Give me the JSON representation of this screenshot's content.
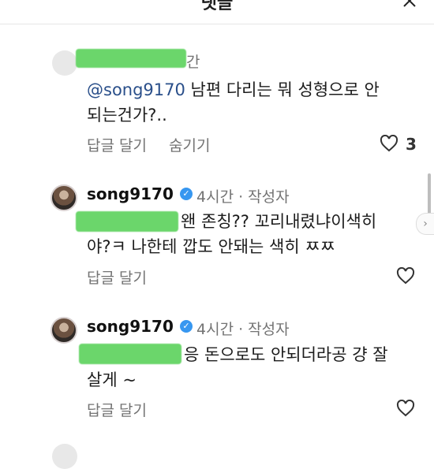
{
  "header": {
    "title": "댓글"
  },
  "comments": [
    {
      "time": "간",
      "mention": "@song9170",
      "text_line1_rest": " 남편 다리는 뭐 성형으로 안",
      "text_line2": "되는건가?..",
      "reply_label": "답글 달기",
      "hide_label": "숨기기",
      "likes": "3"
    },
    {
      "username": "song9170",
      "meta": "4시간 · 작성자",
      "text_line1": "왠 존칭?? 꼬리내렸냐이색히",
      "text_line2": "야?ㅋ  나한테 깝도 안돼는 색히 ㅉㅉ",
      "reply_label": "답글 달기"
    },
    {
      "username": "song9170",
      "meta": "4시간 · 작성자",
      "text_line1": "응 돈으로도 안되더라공 걍 잘",
      "text_line2": "살게 ~",
      "reply_label": "답글 달기"
    }
  ],
  "icons": {
    "close": "close-icon",
    "heart": "heart-icon",
    "verified": "verified-badge-icon"
  },
  "colors": {
    "censor": "#6bd66b",
    "mention": "#2a4f8a",
    "verified": "#3797f0"
  }
}
